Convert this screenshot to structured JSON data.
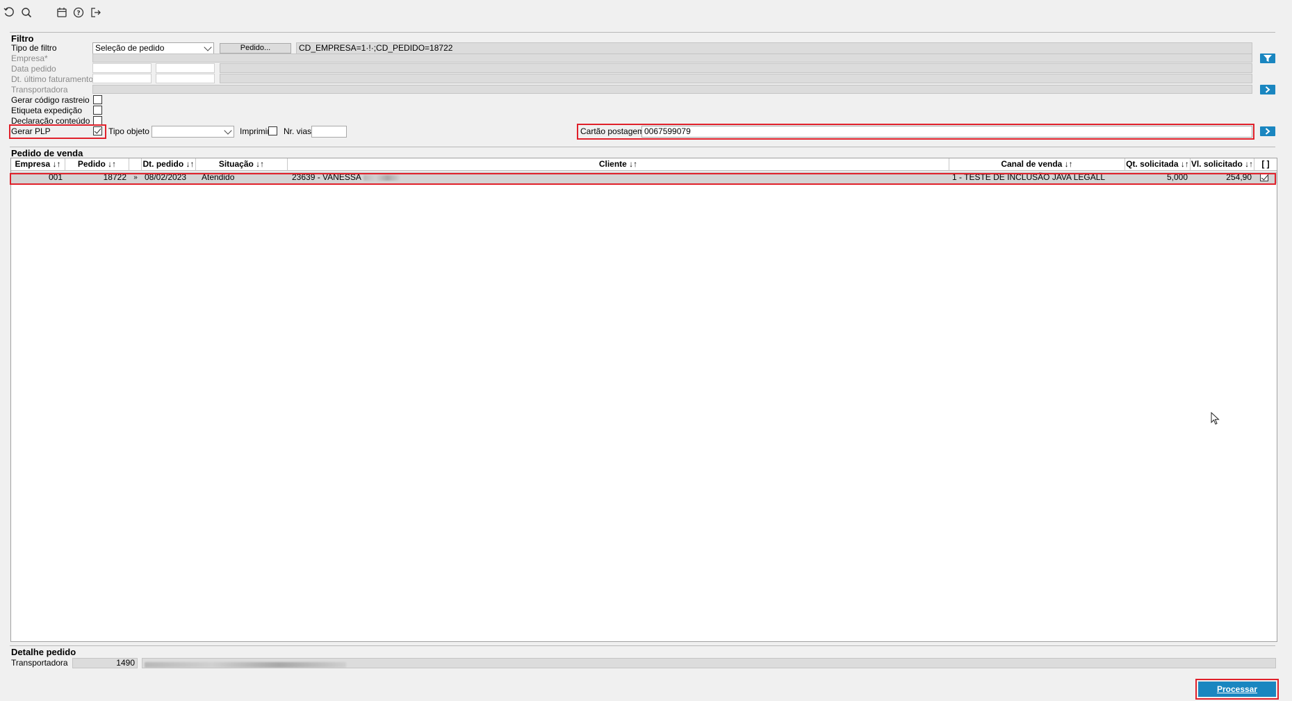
{
  "toolbar": {
    "icons": [
      "refresh-icon",
      "search-icon",
      "calendar-icon",
      "help-icon",
      "exit-icon"
    ]
  },
  "filtro": {
    "title": "Filtro",
    "tipo_filtro_label": "Tipo de filtro",
    "tipo_filtro_value": "Seleção de pedido",
    "pedido_button": "Pedido...",
    "filter_expression": "CD_EMPRESA=1·!·;CD_PEDIDO=18722",
    "empresa_label": "Empresa*",
    "data_pedido_label": "Data pedido",
    "dt_ultimo_faturamento_label": "Dt. último faturamento",
    "transportadora_label": "Transportadora",
    "gerar_codigo_rastreio_label": "Gerar código rastreio",
    "etiqueta_expedicao_label": "Etiqueta expedição",
    "declaracao_conteudo_label": "Declaração conteúdo",
    "gerar_plp_label": "Gerar PLP",
    "gerar_plp_checked": true,
    "tipo_objeto_label": "Tipo objeto",
    "tipo_objeto_value": "",
    "imprimir_label": "Imprimir",
    "nr_vias_label": "Nr. vias",
    "nr_vias_value": "",
    "cartao_postagem_label": "Cartão postagem",
    "cartao_postagem_value": "0067599079"
  },
  "pedido_venda": {
    "title": "Pedido de venda",
    "columns": {
      "empresa": "Empresa ↓↑",
      "pedido": "Pedido ↓↑",
      "dt_pedido": "Dt. pedido ↓↑",
      "situacao": "Situação ↓↑",
      "cliente": "Cliente ↓↑",
      "canal_venda": "Canal de venda ↓↑",
      "qt_solicitada": "Qt. solicitada ↓↑",
      "vl_solicitado": "Vl. solicitado ↓↑",
      "select": "[ ]"
    },
    "rows": [
      {
        "empresa": "001",
        "pedido": "18722",
        "expand": "»",
        "dt_pedido": "08/02/2023",
        "situacao": "Atendido",
        "cliente": "23639 - VANESSA",
        "canal_venda": "1 - TESTE DE INCLUSÃO JAVA LEGALL",
        "qt_solicitada": "5,000",
        "vl_solicitado": "254,90",
        "selected": true
      }
    ]
  },
  "detalhe_pedido": {
    "title": "Detalhe pedido",
    "transportadora_label": "Transportadora",
    "transportadora_code": "1490"
  },
  "footer": {
    "processar_label": "Processar"
  },
  "colors": {
    "accent": "#1a86c0",
    "highlight": "#e0202a",
    "selected_row": "#d4d4d4"
  }
}
